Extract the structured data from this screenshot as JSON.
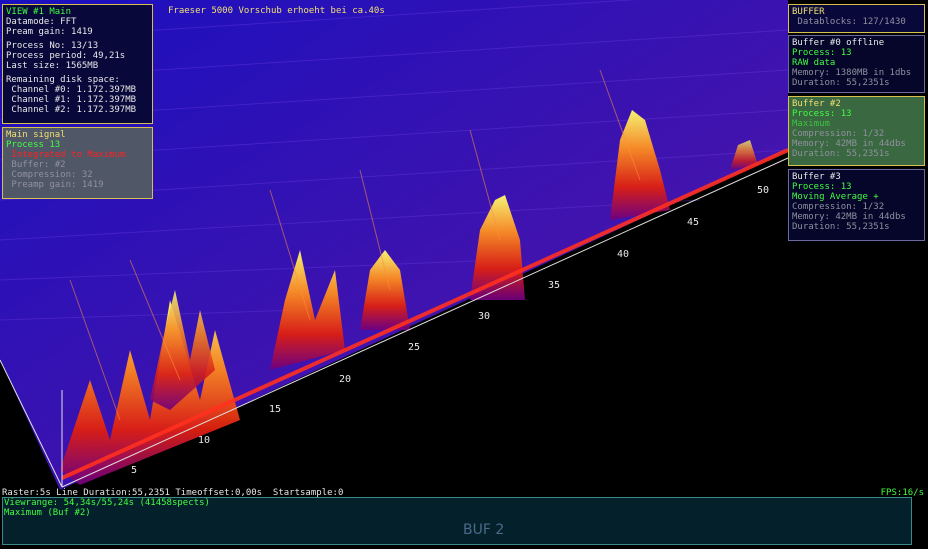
{
  "title": "Fraeser 5000 Vorschub erhoeht bei ca.40s",
  "view_panel": {
    "title": "VIEW #1 Main",
    "lines": [
      "Datamode: FFT",
      "Pream gain: 1419",
      "",
      "Process No: 13/13",
      "Process period: 49,21s",
      "Last size: 1565MB",
      "",
      "Remaining disk space:",
      " Channel #0: 1.172.397MB",
      " Channel #1: 1.172.397MB",
      " Channel #2: 1.172.397MB"
    ]
  },
  "signal_panel": {
    "title": "Main signal",
    "process": "Process 13",
    "warning": " Integrated to Maximum",
    "lines": [
      " Buffer: #2",
      " Compression: 32",
      " Preamp gain: 1419"
    ]
  },
  "buffer_panel": {
    "title": "BUFFER",
    "datablocks": " Datablocks: 127/1430"
  },
  "buffers": [
    {
      "title": "Buffer #0 offline",
      "process": "Process: 13",
      "mode": "RAW data",
      "lines": [
        "Memory: 1380MB in 1dbs",
        "Duration: 55,2351s"
      ]
    },
    {
      "title": "Buffer #2",
      "process": "Process: 13",
      "mode": "Maximum",
      "lines": [
        "Compression: 1/32",
        "Memory: 42MB in 44dbs",
        "Duration: 55,2351s"
      ]
    },
    {
      "title": "Buffer #3",
      "process": "Process: 13",
      "mode": "Moving Average +",
      "lines": [
        "Compression: 1/32",
        "Memory: 42MB in 44dbs",
        "Duration: 55,2351s"
      ]
    }
  ],
  "time_ticks": [
    "5",
    "10",
    "15",
    "20",
    "25",
    "30",
    "35",
    "40",
    "45",
    "50"
  ],
  "status": "Raster:5s Line Duration:55,2351 Timeoffset:0,00s  Startsample:0",
  "fps": "FPS:16/s",
  "overview": {
    "line1": "Viewrange: 54,34s/55,24s (41458spects)",
    "line2": "Maximum (Buf #2)",
    "watermark": "BUF 2"
  },
  "colors": {
    "accent": "#d8c050",
    "active": "#40ff40",
    "warning": "#ff2020",
    "spectrum_low": "#2020c0",
    "spectrum_high": "#ffff60"
  }
}
